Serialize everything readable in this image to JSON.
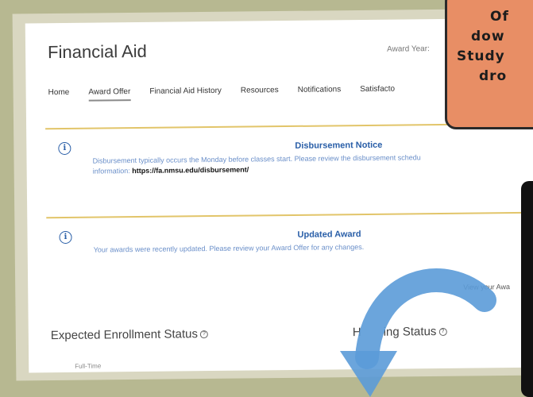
{
  "header": {
    "title": "Financial Aid",
    "award_year_label": "Award Year:"
  },
  "nav": {
    "items": [
      {
        "label": "Home"
      },
      {
        "label": "Award Offer"
      },
      {
        "label": "Financial Aid History"
      },
      {
        "label": "Resources"
      },
      {
        "label": "Notifications"
      },
      {
        "label": "Satisfacto"
      }
    ],
    "active_index": 1
  },
  "notices": [
    {
      "title": "Disbursement Notice",
      "body_line1": "Disbursement typically occurs the Monday before classes start. Please review the disbursement schedu",
      "body_line2_prefix": "information: ",
      "link": "https://fa.nmsu.edu/disbursement/"
    },
    {
      "title": "Updated Award",
      "body_line1": "Your awards were recently updated. Please review your Award Offer for any changes."
    }
  ],
  "view_award_link": "View your Awa",
  "sections": {
    "enrollment_heading": "Expected Enrollment Status",
    "enrollment_value": "Full-Time",
    "housing_heading_left": "H",
    "housing_heading_right": "ing Status"
  },
  "callout": {
    "lines": [
      "Of",
      "dow",
      "Study",
      "dro"
    ]
  },
  "colors": {
    "accent_blue": "#2a5fa8",
    "gold_divider": "#e2c56a",
    "callout_fill": "#e88e65",
    "arrow_blue": "#5b9bd8"
  }
}
